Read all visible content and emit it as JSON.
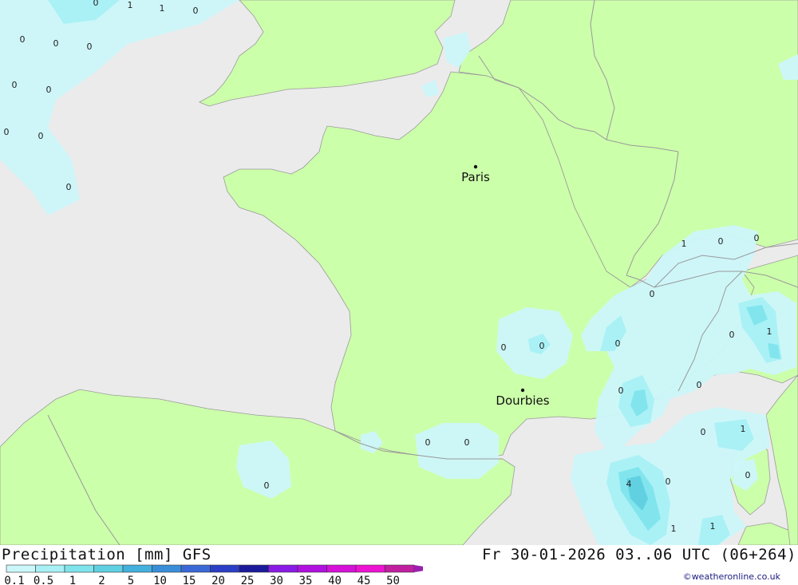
{
  "header": {
    "title": "Precipitation [mm] GFS",
    "timestamp": "Fr 30-01-2026 03..06 UTC (06+264)"
  },
  "credit": "©weatheronline.co.uk",
  "colors": {
    "sea": "#ebebeb",
    "land": "#ccffaa",
    "border": "#999999"
  },
  "cities": [
    {
      "name": "Paris"
    },
    {
      "name": "Dourbies"
    }
  ],
  "value_labels": [
    "0",
    "1",
    "1",
    "0",
    "0",
    "0",
    "0",
    "0",
    "0",
    "0",
    "0",
    "0",
    "0",
    "1",
    "0",
    "0",
    "0",
    "0",
    "0",
    "1",
    "0",
    "0",
    "0",
    "0",
    "0",
    "0",
    "1",
    "0",
    "0",
    "4",
    "0",
    "1",
    "1"
  ],
  "legend": {
    "items": [
      {
        "label": "0.1",
        "color": "#ccf7fa"
      },
      {
        "label": "0.5",
        "color": "#a8f0f5"
      },
      {
        "label": "1",
        "color": "#7fe4ec"
      },
      {
        "label": "2",
        "color": "#5fd0e2"
      },
      {
        "label": "5",
        "color": "#44b0de"
      },
      {
        "label": "10",
        "color": "#3a8ed9"
      },
      {
        "label": "15",
        "color": "#3a68d6"
      },
      {
        "label": "20",
        "color": "#2a3fc5"
      },
      {
        "label": "25",
        "color": "#1a1a9a"
      },
      {
        "label": "30",
        "color": "#8a1ae6"
      },
      {
        "label": "35",
        "color": "#b011e0"
      },
      {
        "label": "40",
        "color": "#d610d8"
      },
      {
        "label": "45",
        "color": "#ee12d2"
      },
      {
        "label": "50",
        "color": "#c01fa0"
      }
    ],
    "arrow_color": "#9a1fb0"
  }
}
